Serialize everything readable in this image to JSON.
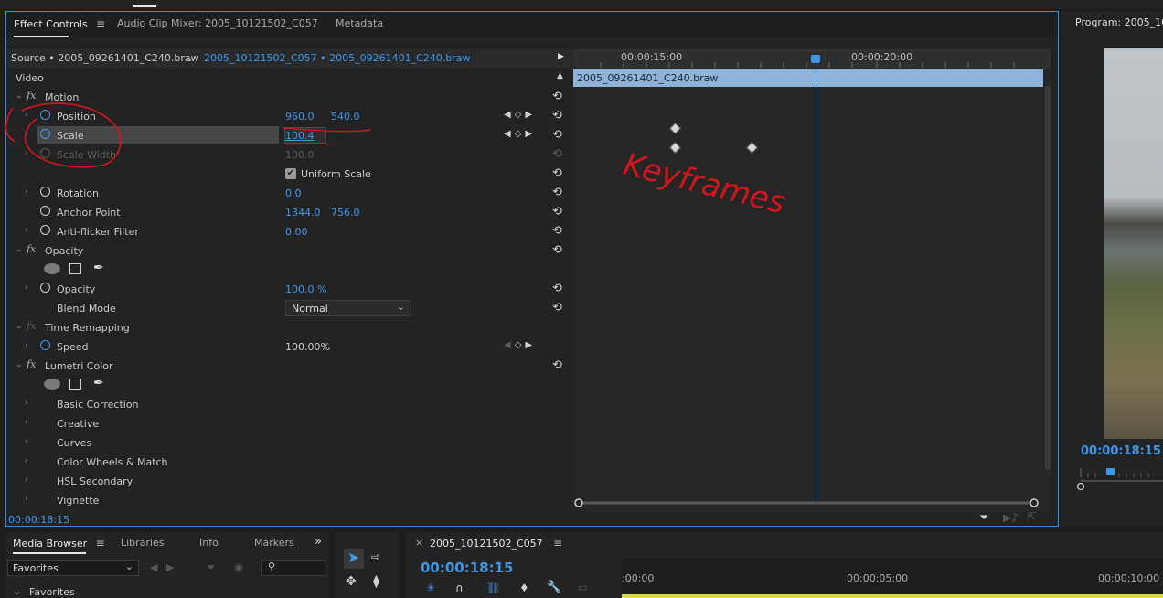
{
  "tabs": [
    {
      "label": "Effect Controls",
      "active": true
    },
    {
      "label": "Audio Clip Mixer: 2005_10121502_C057",
      "active": false
    },
    {
      "label": "Metadata",
      "active": false
    }
  ],
  "source": {
    "source_label": "Source • 2005_09261401_C240.braw",
    "sequence_label": "2005_10121502_C057 • 2005_09261401_C240.braw"
  },
  "timeline": {
    "ruler_labels": [
      "00:00:15:00",
      "00:00:20:00"
    ],
    "clip_name": "2005_09261401_C240.braw"
  },
  "sections": {
    "video": "Video",
    "motion": "Motion",
    "opacity_fx": "Opacity",
    "time_remap": "Time Remapping",
    "lumetri": "Lumetri Color"
  },
  "params": {
    "position": {
      "label": "Position",
      "x": "960.0",
      "y": "540.0"
    },
    "scale": {
      "label": "Scale",
      "value": "100.4"
    },
    "scale_width": {
      "label": "Scale Width",
      "value": "100.0"
    },
    "uniform_scale": {
      "label": "Uniform Scale",
      "checked": true
    },
    "rotation": {
      "label": "Rotation",
      "value": "0.0"
    },
    "anchor": {
      "label": "Anchor Point",
      "x": "1344.0",
      "y": "756.0"
    },
    "antiflicker": {
      "label": "Anti-flicker Filter",
      "value": "0.00"
    },
    "opacity": {
      "label": "Opacity",
      "value": "100.0 %"
    },
    "blend": {
      "label": "Blend Mode",
      "value": "Normal"
    },
    "speed": {
      "label": "Speed",
      "value": "100.00%"
    }
  },
  "lumetri_items": [
    "Basic Correction",
    "Creative",
    "Curves",
    "Color Wheels & Match",
    "HSL Secondary",
    "Vignette"
  ],
  "timecode": "00:00:18:15",
  "annotation": "Keyframes",
  "program": {
    "title": "Program: 2005_101",
    "timecode": "00:00:18:15"
  },
  "bottom": {
    "tabs": [
      "Media Browser",
      "Libraries",
      "Info",
      "Markers"
    ],
    "overflow": "»",
    "favorites_dropdown": "Favorites",
    "favorites_tree": "Favorites",
    "sequence_tab": "2005_10121502_C057",
    "sequence_timecode": "00:00:18:15",
    "ruler_labels": [
      ":00:00",
      "00:00:05:00",
      "00:00:10:00"
    ]
  }
}
